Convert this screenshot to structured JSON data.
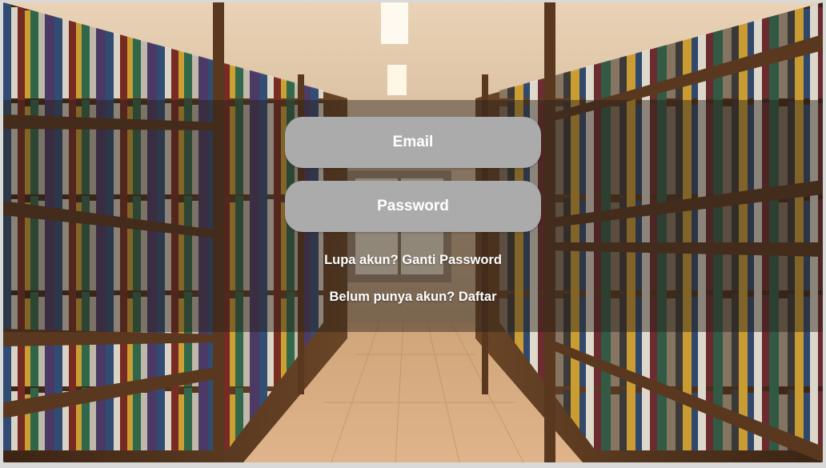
{
  "login": {
    "email_placeholder": "Email",
    "password_placeholder": "Password",
    "forgot_link": "Lupa akun? Ganti Password",
    "register_link": "Belum punya akun? Daftar"
  },
  "colors": {
    "field_bg": "#ababab",
    "text": "#ffffff"
  }
}
